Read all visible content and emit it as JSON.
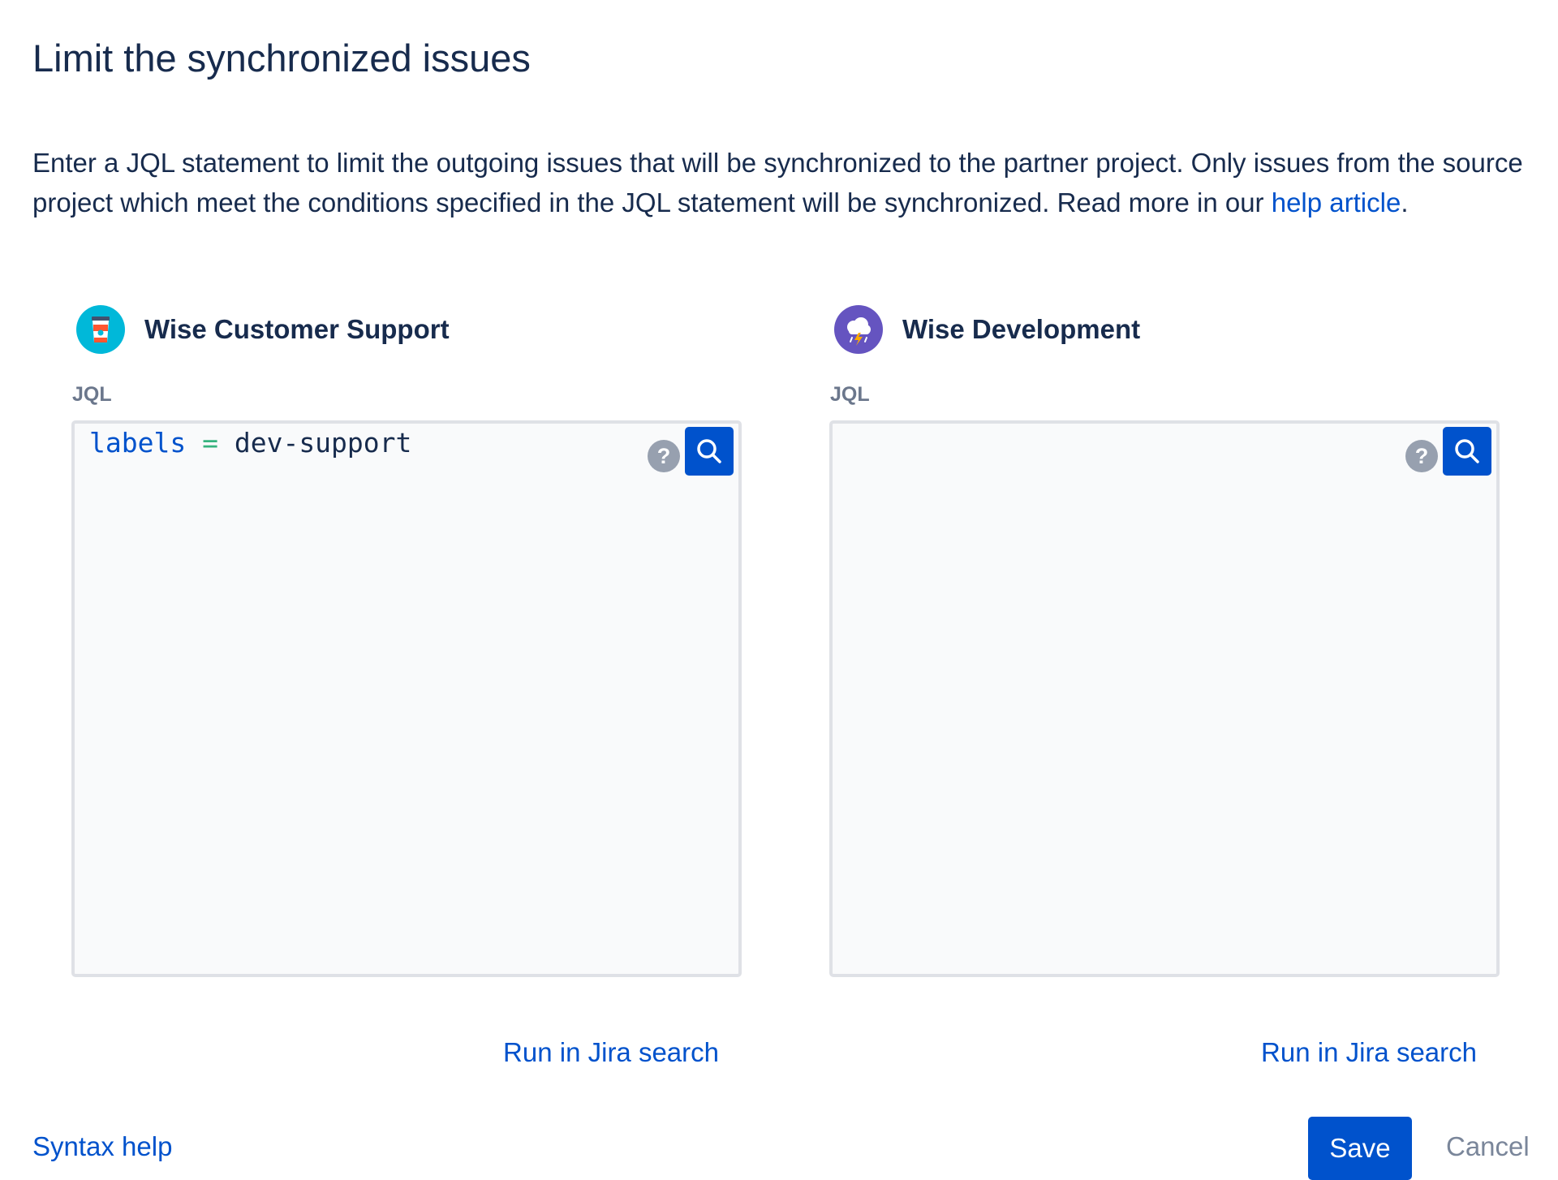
{
  "dialog": {
    "title": "Limit the synchronized issues",
    "description": {
      "text": "Enter a JQL statement to limit the outgoing issues that will be synchronized to the partner project. Only issues from the source project which meet the conditions specified in the JQL statement will be synchronized. Read more in our ",
      "link_text": "help article",
      "suffix": "."
    }
  },
  "panels": [
    {
      "project_name": "Wise Customer Support",
      "avatar_icon": "coffee-cup-icon",
      "jql_label": "JQL",
      "jql": {
        "field": "labels",
        "operator": "=",
        "value": "dev-support"
      },
      "help_icon_text": "?",
      "search_icon": "search-icon",
      "run_link": "Run in Jira search"
    },
    {
      "project_name": "Wise Development",
      "avatar_icon": "storm-cloud-icon",
      "jql_label": "JQL",
      "jql": {
        "field": "",
        "operator": "",
        "value": ""
      },
      "help_icon_text": "?",
      "search_icon": "search-icon",
      "run_link": "Run in Jira search"
    }
  ],
  "footer": {
    "syntax_help": "Syntax help",
    "save_label": "Save",
    "cancel_label": "Cancel"
  },
  "colors": {
    "primary": "#0052cc",
    "text": "#172b4d",
    "subtle": "#6b778c",
    "editor_bg": "#f9fafb",
    "editor_border": "#dfe1e6",
    "jql_operator": "#36b37e",
    "avatar_support": "#00b8d9",
    "avatar_development": "#6554c0"
  }
}
